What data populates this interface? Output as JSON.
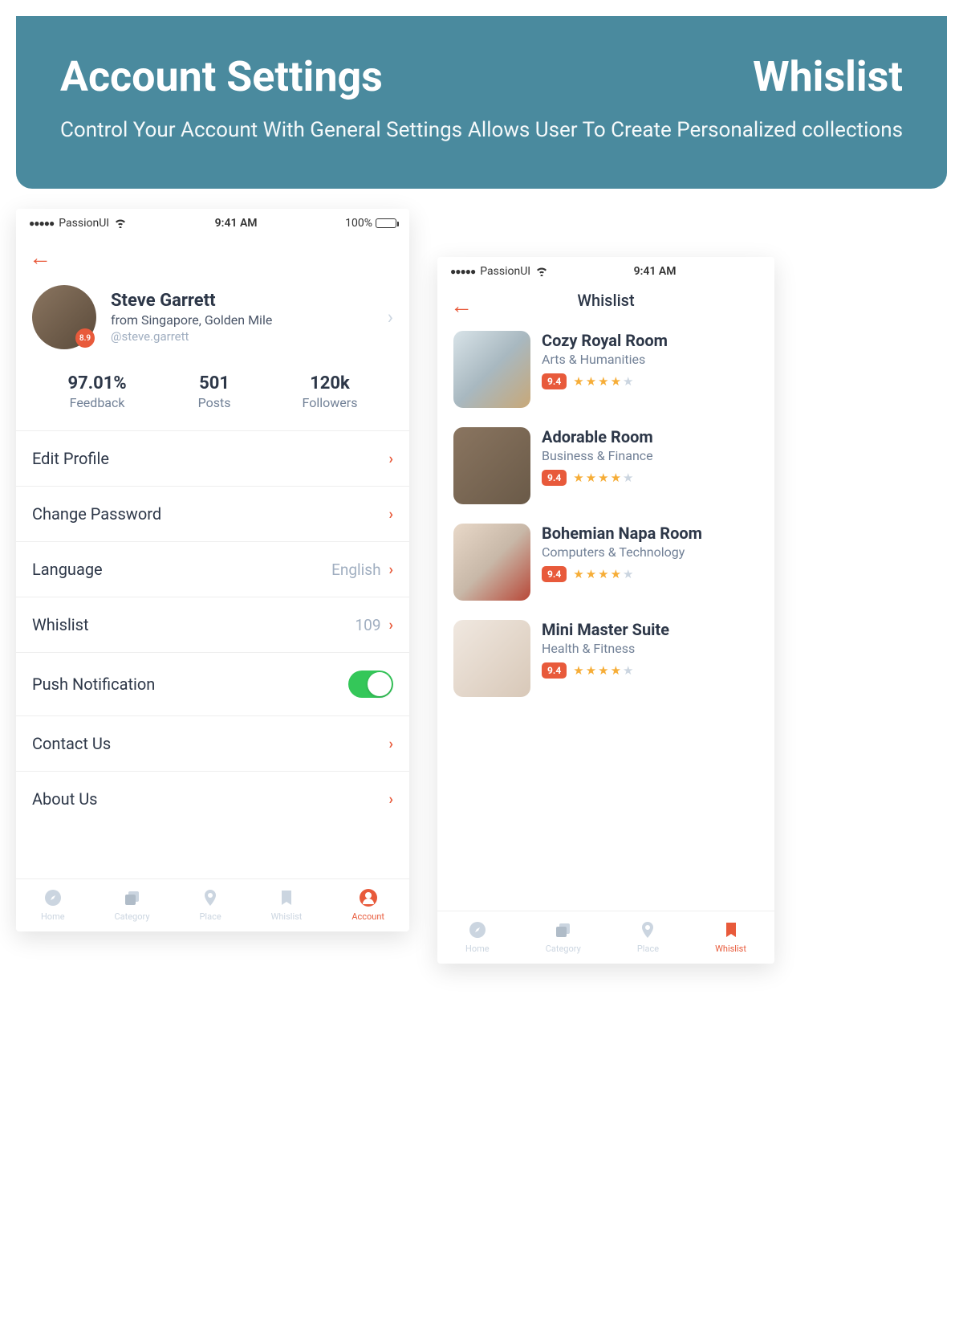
{
  "header": {
    "left_title": "Account Settings",
    "left_sub": "Control Your Account With General Settings",
    "right_title": "Whislist",
    "right_sub": "Allows User To Create Personalized collections"
  },
  "status": {
    "carrier": "PassionUI",
    "time": "9:41 AM",
    "battery": "100%"
  },
  "profile": {
    "name": "Steve Garrett",
    "location": "from Singapore, Golden Mile",
    "handle": "@steve.garrett",
    "badge": "8.9"
  },
  "stats": {
    "feedback_value": "97.01%",
    "feedback_label": "Feedback",
    "posts_value": "501",
    "posts_label": "Posts",
    "followers_value": "120k",
    "followers_label": "Followers"
  },
  "menu": {
    "edit_profile": "Edit Profile",
    "change_password": "Change Password",
    "language": "Language",
    "language_value": "English",
    "whislist": "Whislist",
    "whislist_value": "109",
    "push": "Push Notification",
    "contact": "Contact Us",
    "about": "About Us"
  },
  "tabs": {
    "home": "Home",
    "category": "Category",
    "place": "Place",
    "whislist": "Whislist",
    "account": "Account"
  },
  "wishlist_page": {
    "title": "Whislist",
    "items": [
      {
        "name": "Cozy Royal Room",
        "cat": "Arts & Humanities",
        "rating": "9.4"
      },
      {
        "name": "Adorable Room",
        "cat": "Business & Finance",
        "rating": "9.4"
      },
      {
        "name": "Bohemian Napa Room",
        "cat": "Computers & Technology",
        "rating": "9.4"
      },
      {
        "name": "Mini Master Suite",
        "cat": "Health & Fitness",
        "rating": "9.4"
      }
    ]
  }
}
